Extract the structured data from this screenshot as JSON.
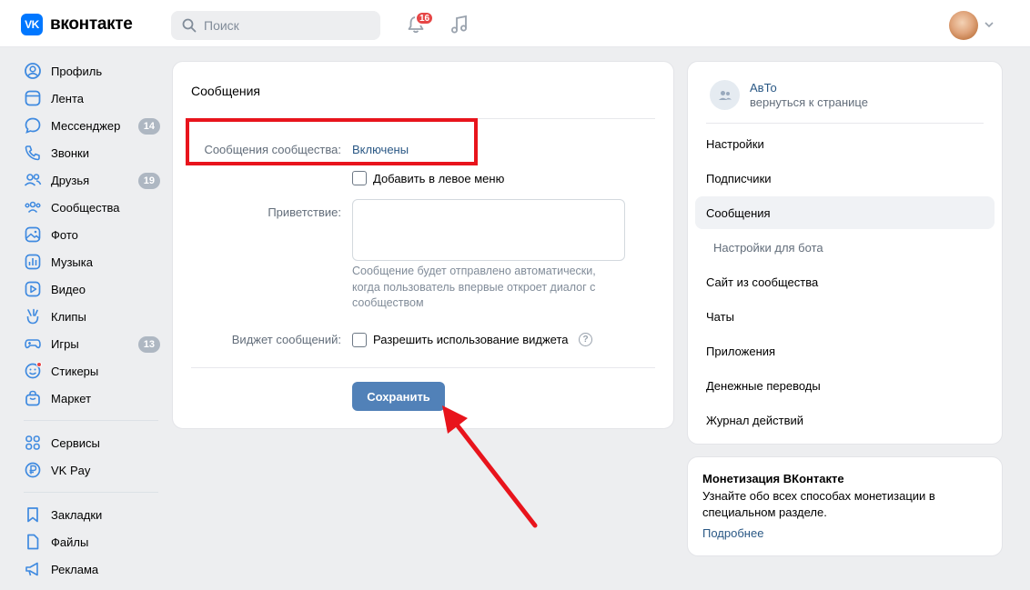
{
  "header": {
    "logo_mark": "VK",
    "logo_text": "вконтакте",
    "search_placeholder": "Поиск",
    "notifications_count": "16"
  },
  "sidebar": {
    "items": [
      {
        "label": "Профиль",
        "icon": "profile-icon"
      },
      {
        "label": "Лента",
        "icon": "feed-icon"
      },
      {
        "label": "Мессенджер",
        "icon": "messenger-icon",
        "count": "14"
      },
      {
        "label": "Звонки",
        "icon": "phone-icon"
      },
      {
        "label": "Друзья",
        "icon": "friends-icon",
        "count": "19"
      },
      {
        "label": "Сообщества",
        "icon": "communities-icon"
      },
      {
        "label": "Фото",
        "icon": "photo-icon"
      },
      {
        "label": "Музыка",
        "icon": "music-icon"
      },
      {
        "label": "Видео",
        "icon": "video-icon"
      },
      {
        "label": "Клипы",
        "icon": "clips-icon"
      },
      {
        "label": "Игры",
        "icon": "games-icon",
        "count": "13"
      },
      {
        "label": "Стикеры",
        "icon": "stickers-icon"
      },
      {
        "label": "Маркет",
        "icon": "market-icon"
      }
    ],
    "items2": [
      {
        "label": "Сервисы",
        "icon": "services-icon"
      },
      {
        "label": "VK Pay",
        "icon": "vkpay-icon"
      }
    ],
    "items3": [
      {
        "label": "Закладки",
        "icon": "bookmarks-icon"
      },
      {
        "label": "Файлы",
        "icon": "files-icon"
      },
      {
        "label": "Реклама",
        "icon": "ads-icon"
      }
    ]
  },
  "main": {
    "title": "Сообщения",
    "community_messages_label": "Сообщения сообщества:",
    "community_messages_value": "Включены",
    "add_left_menu_label": "Добавить в левое меню",
    "greeting_label": "Приветствие:",
    "greeting_value": "",
    "greeting_hint": "Сообщение будет отправлено автоматически, когда пользователь впервые откроет диалог с сообществом",
    "widget_label": "Виджет сообщений:",
    "widget_checkbox_label": "Разрешить использование виджета",
    "help_glyph": "?",
    "save_label": "Сохранить"
  },
  "right_menu": {
    "group_name": "АвТо",
    "back_link": "вернуться к странице",
    "items": [
      {
        "label": "Настройки"
      },
      {
        "label": "Подписчики"
      },
      {
        "label": "Сообщения"
      },
      {
        "label": "Настройки для бота"
      },
      {
        "label": "Сайт из сообщества"
      },
      {
        "label": "Чаты"
      },
      {
        "label": "Приложения"
      },
      {
        "label": "Денежные переводы"
      },
      {
        "label": "Журнал действий"
      }
    ]
  },
  "monetization": {
    "title": "Монетизация ВКонтакте",
    "text": "Узнайте обо всех способах монетизации в специальном разделе.",
    "link": "Подробнее"
  },
  "colors": {
    "accent": "#0077ff",
    "link": "#2a5885",
    "button": "#5181b8",
    "highlight_red": "#e8141c",
    "badge_red": "#e64646"
  }
}
